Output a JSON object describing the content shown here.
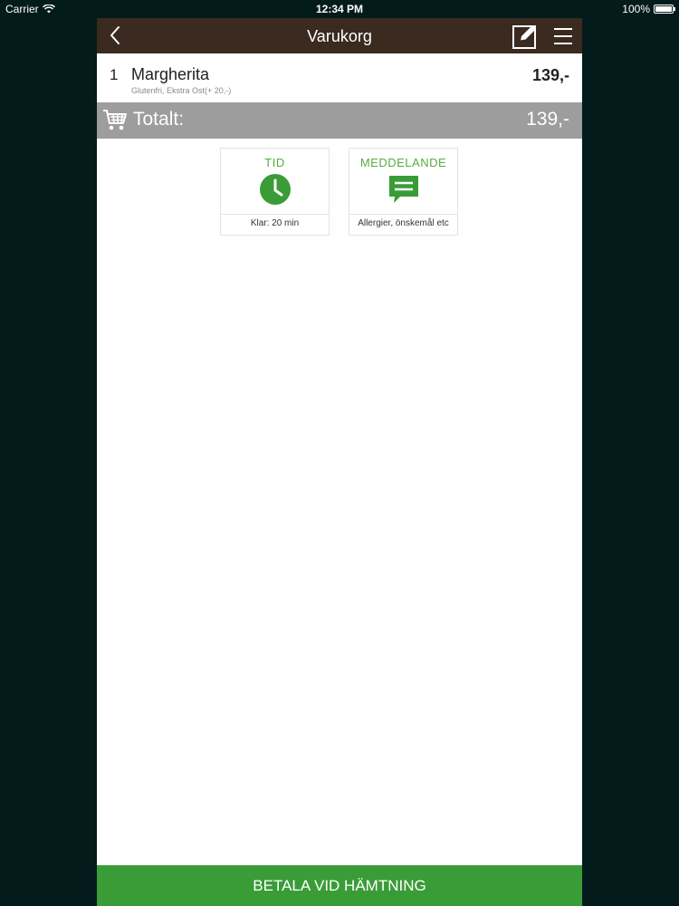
{
  "status_bar": {
    "carrier": "Carrier",
    "time": "12:34 PM",
    "battery": "100%",
    "battery_level": 1.0
  },
  "navbar": {
    "title": "Varukorg",
    "bg_color": "#3a2a1f",
    "icons": [
      "back-chevron-icon",
      "edit-icon",
      "menu-icon"
    ]
  },
  "cart": {
    "items": [
      {
        "qty": "1",
        "name": "Margherita",
        "details": "Glutenfri, Ekstra Ost(+ 20,-)",
        "price": "139,-"
      }
    ],
    "total_label": "Totalt:",
    "total_value": "139,-"
  },
  "options": [
    {
      "heading": "TID",
      "icon": "clock-icon",
      "caption": "Klar: 20 min"
    },
    {
      "heading": "MEDDELANDE",
      "icon": "message-icon",
      "caption": "Allergier, önskemål etc"
    }
  ],
  "pay_button": {
    "label": "BETALA VID HÄMTNING",
    "color": "#3a9c37"
  },
  "colors": {
    "accent_green": "#57ab3f",
    "total_bar": "#9d9d9d",
    "background": "#041b1b"
  }
}
